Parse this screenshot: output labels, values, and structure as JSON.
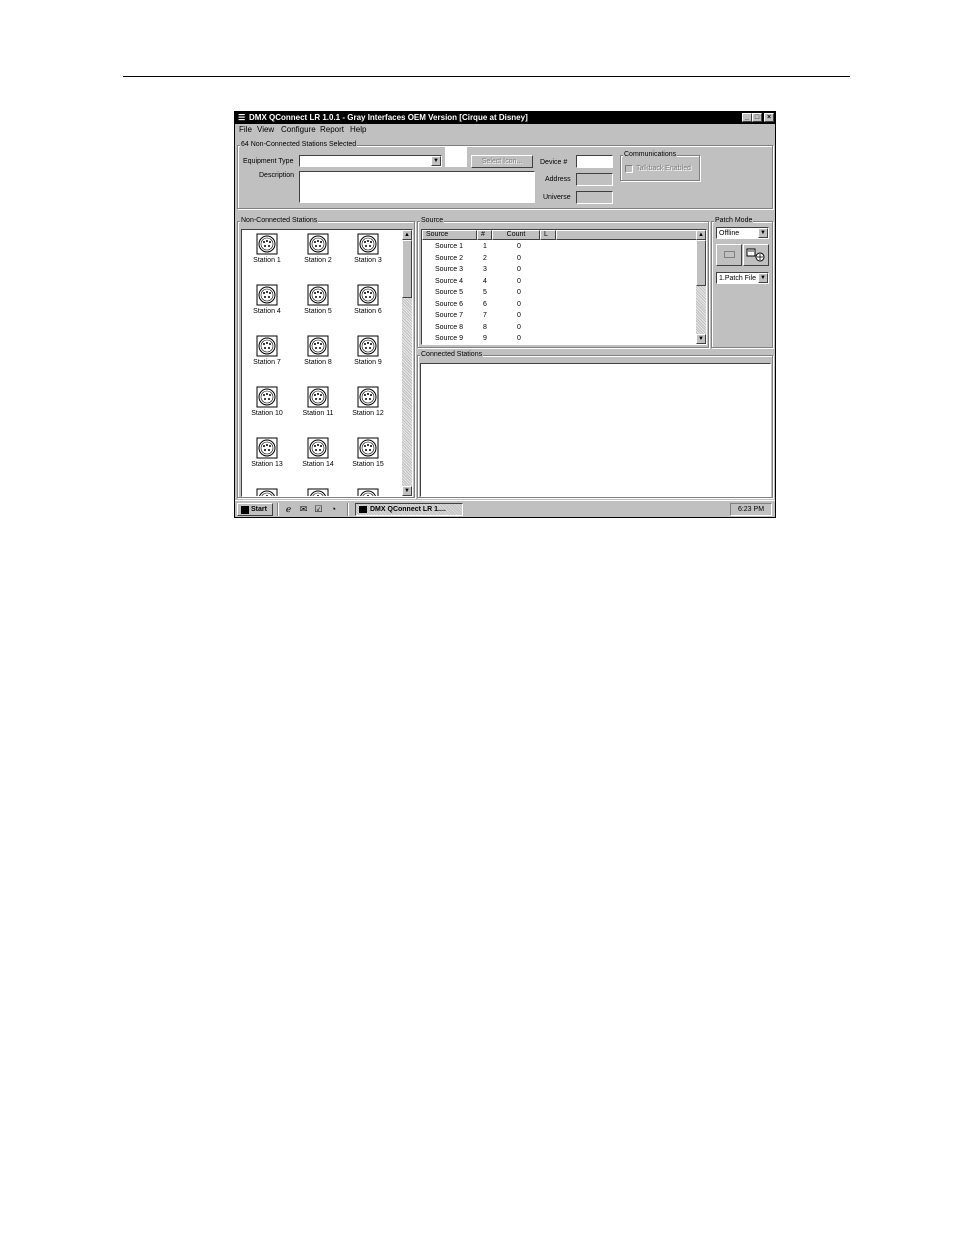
{
  "window": {
    "title": "DMX QConnect LR 1.0.1 - Gray Interfaces OEM Version [Cirque at Disney]",
    "minimize": "_",
    "maximize": "□",
    "close": "×"
  },
  "menu": [
    "File",
    "View",
    "Configure",
    "Report",
    "Help"
  ],
  "equipment": {
    "group_label": "64 Non-Connected Stations Selected",
    "type_label": "Equipment Type",
    "type_value": "",
    "description_label": "Description",
    "description_value": "",
    "select_icon_button": "Select Icon...",
    "device_label": "Device #",
    "device_value": "",
    "address_label": "Address",
    "universe_label": "Universe"
  },
  "communications": {
    "group_label": "Communications",
    "talkback_label": "Talkback Enabled"
  },
  "non_connected": {
    "group_label": "Non-Connected Stations",
    "stations": [
      "Station 1",
      "Station 2",
      "Station 3",
      "Station 4",
      "Station 5",
      "Station 6",
      "Station 7",
      "Station 8",
      "Station 9",
      "Station 10",
      "Station 11",
      "Station 12",
      "Station 13",
      "Station 14",
      "Station 15"
    ]
  },
  "source": {
    "group_label": "Source",
    "columns": [
      "Source",
      "#",
      "Count",
      "L"
    ],
    "rows": [
      {
        "name": "Source 1",
        "num": "1",
        "count": "0"
      },
      {
        "name": "Source 2",
        "num": "2",
        "count": "0"
      },
      {
        "name": "Source 3",
        "num": "3",
        "count": "0"
      },
      {
        "name": "Source 4",
        "num": "4",
        "count": "0"
      },
      {
        "name": "Source 5",
        "num": "5",
        "count": "0"
      },
      {
        "name": "Source 6",
        "num": "6",
        "count": "0"
      },
      {
        "name": "Source 7",
        "num": "7",
        "count": "0"
      },
      {
        "name": "Source 8",
        "num": "8",
        "count": "0"
      },
      {
        "name": "Source 9",
        "num": "9",
        "count": "0"
      }
    ]
  },
  "patch_mode": {
    "group_label": "Patch Mode",
    "mode_value": "Offline",
    "patch_file_value": "1.Patch File"
  },
  "connected": {
    "group_label": "Connected Stations"
  },
  "taskbar": {
    "start_label": "Start",
    "task_label": "DMX QConnect LR 1....",
    "clock": "6:23 PM"
  }
}
